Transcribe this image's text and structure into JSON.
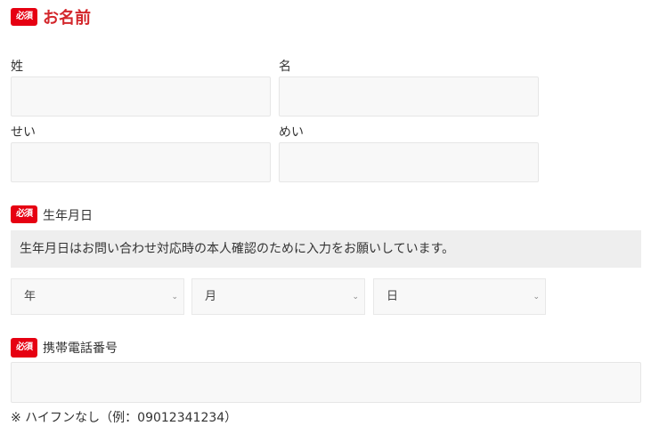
{
  "name_section": {
    "badge": "必須",
    "title": "お名前",
    "last_name_label": "姓",
    "first_name_label": "名",
    "last_kana_label": "せい",
    "first_kana_label": "めい"
  },
  "birthday_section": {
    "badge": "必須",
    "title": "生年月日",
    "notice": "生年月日はお問い合わせ対応時の本人確認のために入力をお願いしています。",
    "year": "年",
    "month": "月",
    "day": "日"
  },
  "phone_section": {
    "badge": "必須",
    "title": "携帯電話番号",
    "note": "※ ハイフンなし（例：09012341234）"
  }
}
